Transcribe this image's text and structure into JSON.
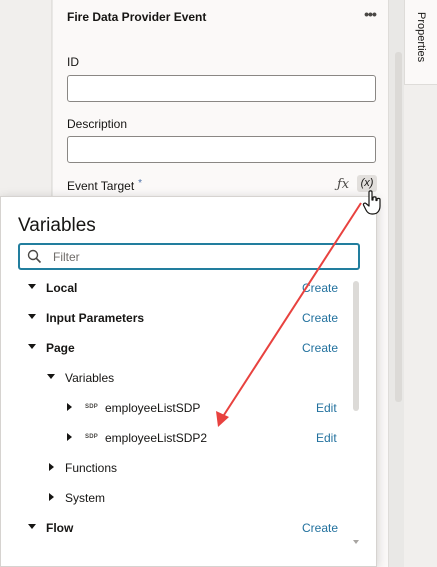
{
  "panel": {
    "title": "Fire Data Provider Event",
    "more_label": "•••",
    "id_label": "ID",
    "id_value": "",
    "description_label": "Description",
    "description_value": "",
    "event_target_label": "Event Target",
    "required_mark": "*",
    "fx_label": "ƒx",
    "variable_picker_label": "(x)"
  },
  "side_tab": {
    "label": "Properties"
  },
  "popup": {
    "title": "Variables",
    "filter_placeholder": "Filter",
    "tree": {
      "local": {
        "label": "Local",
        "action": "Create"
      },
      "input_parameters": {
        "label": "Input Parameters",
        "action": "Create"
      },
      "page": {
        "label": "Page",
        "action": "Create"
      },
      "variables": {
        "label": "Variables"
      },
      "item1": {
        "badge": "SDP",
        "label": "employeeListSDP",
        "action": "Edit"
      },
      "item2": {
        "badge": "SDP",
        "label": "employeeListSDP2",
        "action": "Edit"
      },
      "functions": {
        "label": "Functions"
      },
      "system": {
        "label": "System"
      },
      "flow": {
        "label": "Flow",
        "action": "Create"
      }
    }
  },
  "colors": {
    "accent": "#227e9e",
    "link": "#22719e",
    "arrow": "#e8423f"
  }
}
